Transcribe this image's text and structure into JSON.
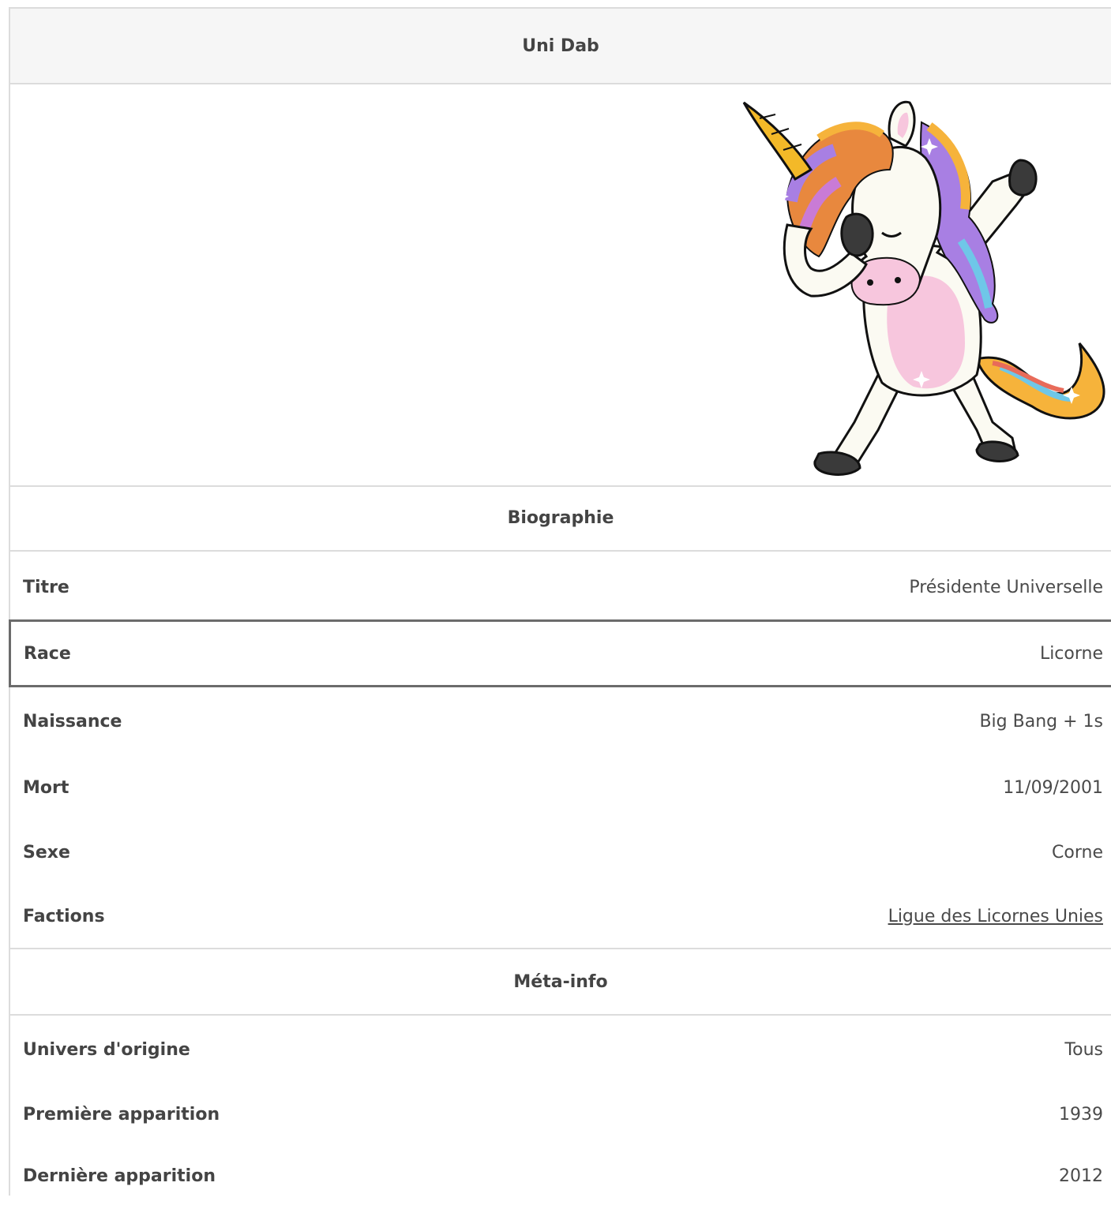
{
  "infobox": {
    "title": "Uni Dab",
    "sections": {
      "biography": {
        "heading": "Biographie",
        "rows": [
          {
            "label": "Titre",
            "value": "Présidente Universelle"
          },
          {
            "label": "Race",
            "value": "Licorne"
          },
          {
            "label": "Naissance",
            "value": "Big Bang + 1s"
          },
          {
            "label": "Mort",
            "value": "11/09/2001"
          },
          {
            "label": "Sexe",
            "value": "Corne"
          },
          {
            "label": "Factions",
            "value": "Ligue des Licornes Unies"
          }
        ]
      },
      "meta": {
        "heading": "Méta-info",
        "rows": [
          {
            "label": "Univers d'origine",
            "value": "Tous"
          },
          {
            "label": "Première apparition",
            "value": "1939"
          },
          {
            "label": "Dernière apparition",
            "value": "2012"
          }
        ]
      }
    }
  },
  "colors": {
    "link": "#2a6fa8",
    "header_bg": "#f6f6f6",
    "border": "#dcdcdc",
    "selected_border": "#6b6b6b"
  },
  "icons": {
    "infobox_image": "dabbing-unicorn-illustration"
  }
}
